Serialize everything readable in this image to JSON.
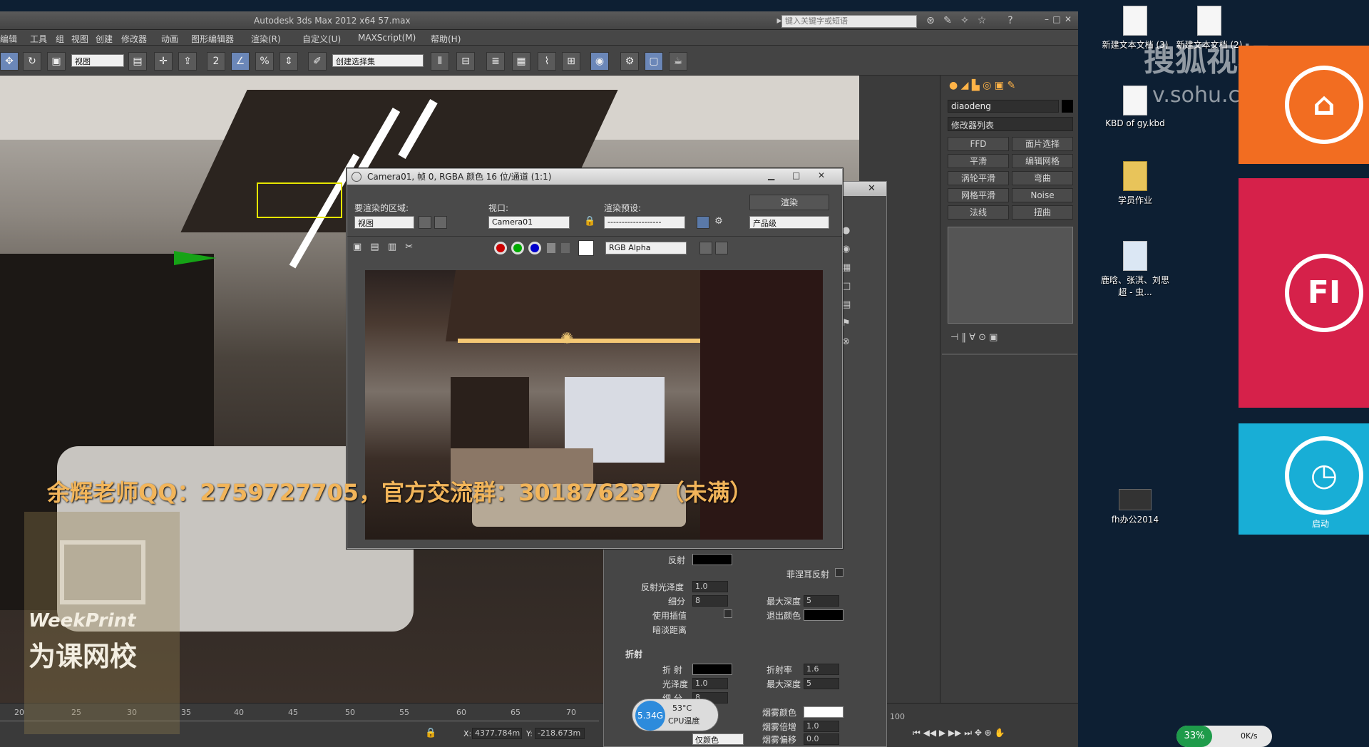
{
  "app": {
    "title": "Autodesk 3ds Max 2012 x64    57.max",
    "search_placeholder": "键入关键字或短语"
  },
  "menu": [
    "编辑",
    "工具",
    "组",
    "视图",
    "创建",
    "修改器",
    "动画",
    "图形编辑器",
    "渲染(R)",
    "自定义(U)",
    "MAXScript(M)",
    "帮助(H)"
  ],
  "toolbar": {
    "view_select": "视图",
    "selset_select": "创建选择集"
  },
  "render": {
    "title": "Camera01, 帧 0, RGBA 颜色 16 位/通道 (1:1)",
    "area_label": "要渲染的区域:",
    "area_value": "视图",
    "viewport_label": "视口:",
    "viewport_value": "Camera01",
    "preset_label": "渲染预设:",
    "preset_value": "-------------------",
    "render_button": "渲染",
    "quality_value": "产品级",
    "channel_value": "RGB Alpha"
  },
  "cmdpanel": {
    "object_name": "diaodeng",
    "modifier_list": "修改器列表",
    "buttons": [
      "FFD",
      "面片选择",
      "平滑",
      "编辑网格",
      "涡轮平滑",
      "弯曲",
      "网格平滑",
      "Noise",
      "法线",
      "扭曲"
    ]
  },
  "material": {
    "reflect_label": "反射",
    "gloss_label": "反射光泽度",
    "gloss_value": "1.0",
    "subdiv_label": "细分",
    "subdiv_value": "8",
    "interp_label": "使用插值",
    "dim_label": "暗淡距离",
    "fresnel_label": "菲涅耳反射",
    "maxdepth_label": "最大深度",
    "maxdepth_value": "5",
    "exit_label": "退出颜色",
    "refract_group": "折射",
    "refract_label": "折 射",
    "ior_label": "折射率",
    "ior_value": "1.6",
    "rgloss_label": "光泽度",
    "rgloss_value": "1.0",
    "rmaxdepth_label": "最大深度",
    "rmaxdepth_value": "5",
    "rsubdiv_label": "细 分",
    "rsubdiv_value": "8",
    "fog_label": "烟雾颜色",
    "fogmult_label": "烟雾倍增",
    "fogmult_value": "1.0",
    "fogbias_label": "烟雾偏移",
    "fogbias_value": "0.0",
    "affect_value": "仅颜色"
  },
  "timeline": {
    "ticks": [
      "20",
      "25",
      "30",
      "35",
      "40",
      "45",
      "50",
      "55",
      "60",
      "65",
      "70",
      "100"
    ],
    "x_coord": "4377.784m",
    "y_coord": "-218.673m"
  },
  "watermark": "余辉老师QQ：2759727705，官方交流群：301876237（未满）",
  "logo": {
    "en": "WeekPrint",
    "cn": "为课网校"
  },
  "cpu": {
    "freq": "5.34G",
    "temp": "53°C",
    "label": "CPU温度"
  },
  "desktop": {
    "icons": [
      "新建文本文档 (3)",
      "新建文本文档 (2)",
      "KBD of gy.kbd",
      "学员作业",
      "鹿晗、张淇、刘思超 - 虫...",
      "fh办公2014"
    ],
    "sohu": "搜狐视频",
    "sohu_url": "v.sohu.com",
    "tile_labels": [
      "FI",
      "启动"
    ],
    "net_percent": "33%",
    "net_speed": "0K/s"
  }
}
